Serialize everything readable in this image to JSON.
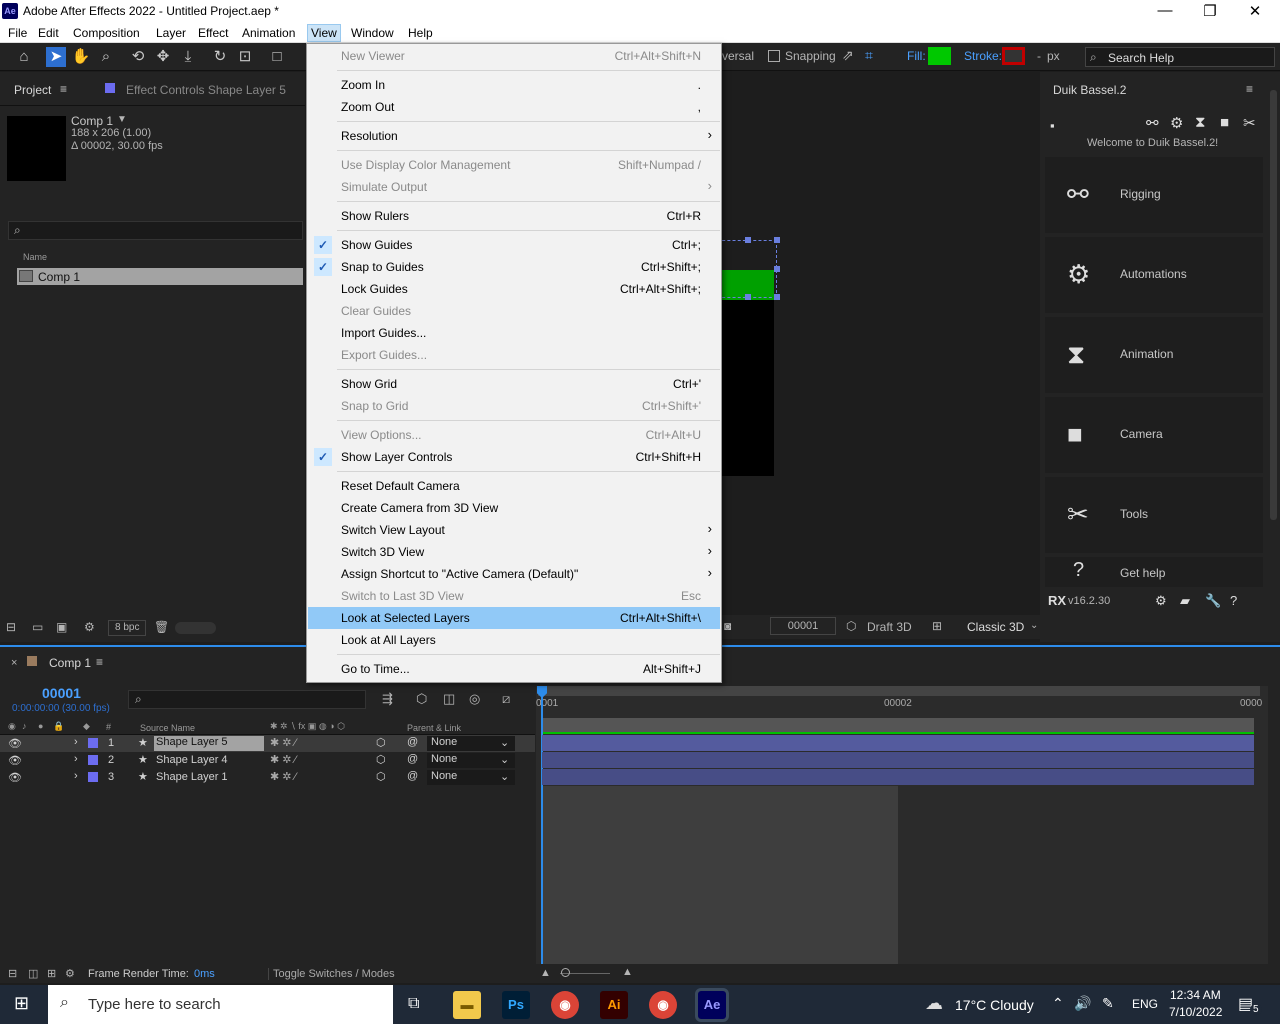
{
  "titlebar": {
    "app_title": "Adobe After Effects 2022 - Untitled Project.aep *",
    "logo": "Ae"
  },
  "menubar": {
    "items": [
      "File",
      "Edit",
      "Composition",
      "Layer",
      "Effect",
      "Animation",
      "View",
      "Window",
      "Help"
    ],
    "active": "View"
  },
  "toolbar": {
    "universal": "versal",
    "snapping": "Snapping",
    "fill": "Fill:",
    "stroke": "Stroke:",
    "dash": "-",
    "px": "px",
    "search_help": "Search Help",
    "fill_color": "#00c800",
    "stroke_color": "#c00000"
  },
  "project": {
    "tab": "Project",
    "effect_controls": "Effect Controls Shape Layer 5",
    "comp_name": "Comp 1",
    "comp_size": "188 x 206 (1.00)",
    "comp_duration": "Δ 00002, 30.00 fps",
    "col_name": "Name",
    "item": "Comp 1",
    "bpc": "8 bpc"
  },
  "viewer": {
    "frame": "00001",
    "draft": "Draft 3D",
    "renderer": "Classic 3D"
  },
  "duik": {
    "title": "Duik Bassel.2",
    "welcome": "Welcome to Duik Bassel.2!",
    "items": [
      {
        "label": "Rigging",
        "icon": "rigging-icon"
      },
      {
        "label": "Automations",
        "icon": "automations-icon"
      },
      {
        "label": "Animation",
        "icon": "animation-icon"
      },
      {
        "label": "Camera",
        "icon": "camera-icon"
      },
      {
        "label": "Tools",
        "icon": "tools-icon"
      },
      {
        "label": "Get help",
        "icon": "help-icon"
      }
    ],
    "version": "v16.2.30"
  },
  "view_menu": {
    "items": [
      {
        "label": "New Viewer",
        "shortcut": "Ctrl+Alt+Shift+N",
        "disabled": true
      },
      {
        "label": "Zoom In",
        "shortcut": ".",
        "disabled": false
      },
      {
        "label": "Zoom Out",
        "shortcut": ",",
        "disabled": false
      },
      {
        "label": "Resolution",
        "shortcut": "",
        "submenu": true
      },
      {
        "label": "Use Display Color Management",
        "shortcut": "Shift+Numpad /",
        "disabled": true
      },
      {
        "label": "Simulate Output",
        "shortcut": "",
        "submenu": true,
        "disabled": true
      },
      {
        "label": "Show Rulers",
        "shortcut": "Ctrl+R"
      },
      {
        "label": "Show Guides",
        "shortcut": "Ctrl+;",
        "checked": true
      },
      {
        "label": "Snap to Guides",
        "shortcut": "Ctrl+Shift+;",
        "checked": true
      },
      {
        "label": "Lock Guides",
        "shortcut": "Ctrl+Alt+Shift+;"
      },
      {
        "label": "Clear Guides",
        "shortcut": "",
        "disabled": true
      },
      {
        "label": "Import Guides...",
        "shortcut": ""
      },
      {
        "label": "Export Guides...",
        "shortcut": "",
        "disabled": true
      },
      {
        "label": "Show Grid",
        "shortcut": "Ctrl+'"
      },
      {
        "label": "Snap to Grid",
        "shortcut": "Ctrl+Shift+'",
        "disabled": true
      },
      {
        "label": "View Options...",
        "shortcut": "Ctrl+Alt+U",
        "disabled": true
      },
      {
        "label": "Show Layer Controls",
        "shortcut": "Ctrl+Shift+H",
        "checked": true
      },
      {
        "label": "Reset Default Camera",
        "shortcut": ""
      },
      {
        "label": "Create Camera from 3D View",
        "shortcut": ""
      },
      {
        "label": "Switch View Layout",
        "shortcut": "",
        "submenu": true
      },
      {
        "label": "Switch 3D View",
        "shortcut": "",
        "submenu": true
      },
      {
        "label": "Assign Shortcut to \"Active Camera (Default)\"",
        "shortcut": "",
        "submenu": true
      },
      {
        "label": "Switch to Last 3D View",
        "shortcut": "Esc",
        "disabled": true
      },
      {
        "label": "Look at Selected Layers",
        "shortcut": "Ctrl+Alt+Shift+\\",
        "highlighted": true
      },
      {
        "label": "Look at All Layers",
        "shortcut": ""
      },
      {
        "label": "Go to Time...",
        "shortcut": "Alt+Shift+J"
      }
    ]
  },
  "timeline": {
    "tab": "Comp 1",
    "timecode": "00001",
    "time_sub": "0:00:00:00 (30.00 fps)",
    "col_source": "Source Name",
    "col_parent": "Parent & Link",
    "ruler_start": "0001",
    "ruler_mid": "00002",
    "ruler_end": "0000",
    "layers": [
      {
        "num": "1",
        "name": "Shape Layer 5",
        "parent": "None"
      },
      {
        "num": "2",
        "name": "Shape Layer 4",
        "parent": "None"
      },
      {
        "num": "3",
        "name": "Shape Layer 1",
        "parent": "None"
      }
    ],
    "render_time_label": "Frame Render Time:",
    "render_time": "0ms",
    "toggle": "Toggle Switches / Modes"
  },
  "taskbar": {
    "search": "Type here to search",
    "weather": "17°C  Cloudy",
    "lang": "ENG",
    "time": "12:34 AM",
    "date": "7/10/2022",
    "notif": "5"
  }
}
